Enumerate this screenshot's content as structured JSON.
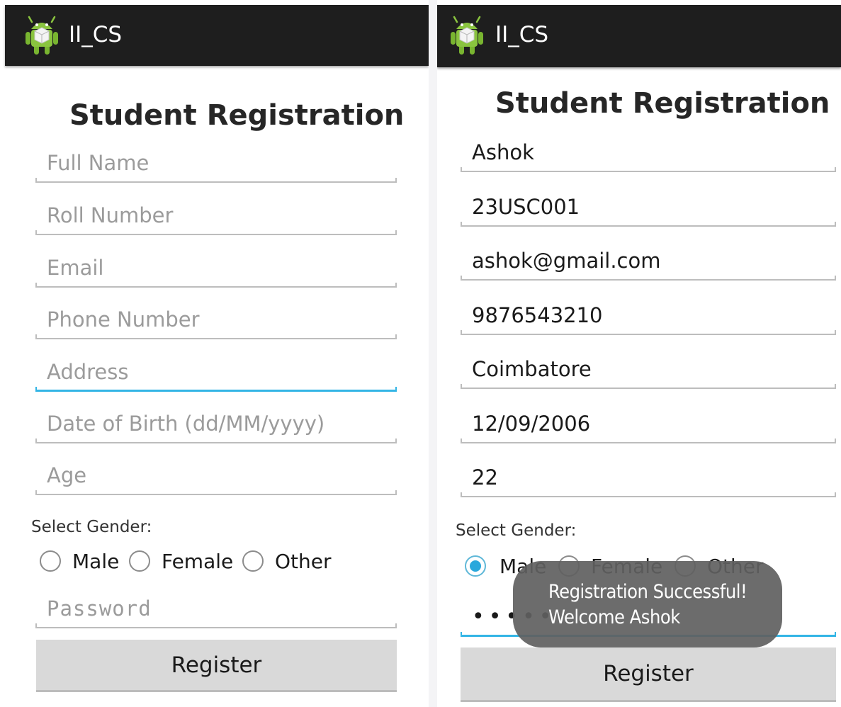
{
  "left": {
    "app_title": "II_CS",
    "form_title": "Student Registration",
    "fields": [
      {
        "placeholder": "Full Name",
        "value": ""
      },
      {
        "placeholder": "Roll Number",
        "value": ""
      },
      {
        "placeholder": "Email",
        "value": ""
      },
      {
        "placeholder": "Phone Number",
        "value": ""
      },
      {
        "placeholder": "Address",
        "value": ""
      },
      {
        "placeholder": "Date of Birth (dd/MM/yyyy)",
        "value": ""
      },
      {
        "placeholder": "Age",
        "value": ""
      }
    ],
    "gender_label": "Select Gender:",
    "gender_options": [
      "Male",
      "Female",
      "Other"
    ],
    "password_placeholder": "Password",
    "register_label": "Register"
  },
  "right": {
    "app_title": "II_CS",
    "form_title": "Student Registration",
    "fields": [
      {
        "value": "Ashok"
      },
      {
        "value": "23USC001"
      },
      {
        "value": "ashok@gmail.com"
      },
      {
        "value": "9876543210"
      },
      {
        "value": "Coimbatore"
      },
      {
        "value": "12/09/2006"
      },
      {
        "value": "22"
      }
    ],
    "gender_label": "Select Gender:",
    "gender_options": [
      "Male",
      "Female",
      "Other"
    ],
    "selected_gender": "Male",
    "password_value": "•••••",
    "register_label": "Register",
    "toast_lines": [
      "Registration Successful!",
      "Welcome Ashok"
    ]
  },
  "colors": {
    "actionbar": "#1e1e1e",
    "focus_accent": "#33b5e5",
    "radio_checked": "#2aa8dc",
    "button_bg": "#d9d9d9",
    "toast_bg": "#5f5f5f"
  },
  "icons": {
    "app": "android-app-icon"
  }
}
